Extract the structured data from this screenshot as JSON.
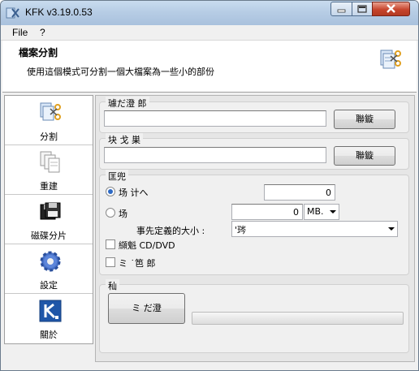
{
  "window": {
    "title": "KFK v3.19.0.53"
  },
  "menu": {
    "file": "File",
    "help": "?"
  },
  "header": {
    "title": "檔案分割",
    "description": "使用這個模式可分割一個大檔案為一些小的部份"
  },
  "sidebar": {
    "items": [
      {
        "label": "分割",
        "icon": "scissors-files-icon"
      },
      {
        "label": "重建",
        "icon": "rebuild-files-icon"
      },
      {
        "label": "磁碟分片",
        "icon": "floppy-disk-icon"
      },
      {
        "label": "設定",
        "icon": "gear-icon"
      },
      {
        "label": "關於",
        "icon": "kfk-logo-icon"
      }
    ]
  },
  "source": {
    "label": "璩だ澄  郎",
    "value": "",
    "browse_label": "聯鏇"
  },
  "target": {
    "label": "块  戈  巣",
    "value": "",
    "browse_label": "聯鏇"
  },
  "options": {
    "label": "匡兜",
    "radio1_label": "场      计へ",
    "radio1_value": "0",
    "radio1_checked": true,
    "radio2_label": "场",
    "radio2_value": "0",
    "radio2_checked": false,
    "unit_value": "MB.",
    "preset_label": "事先定義的大小 :",
    "preset_value": "'琌",
    "checkbox1_label": "纐魁      CD/DVD",
    "checkbox1_checked": false,
    "checkbox2_label": "ミ  ˙笆          郎",
    "checkbox2_checked": false
  },
  "run": {
    "label": "秈",
    "button_label": "ミ  だ澄",
    "progress": 0
  }
}
